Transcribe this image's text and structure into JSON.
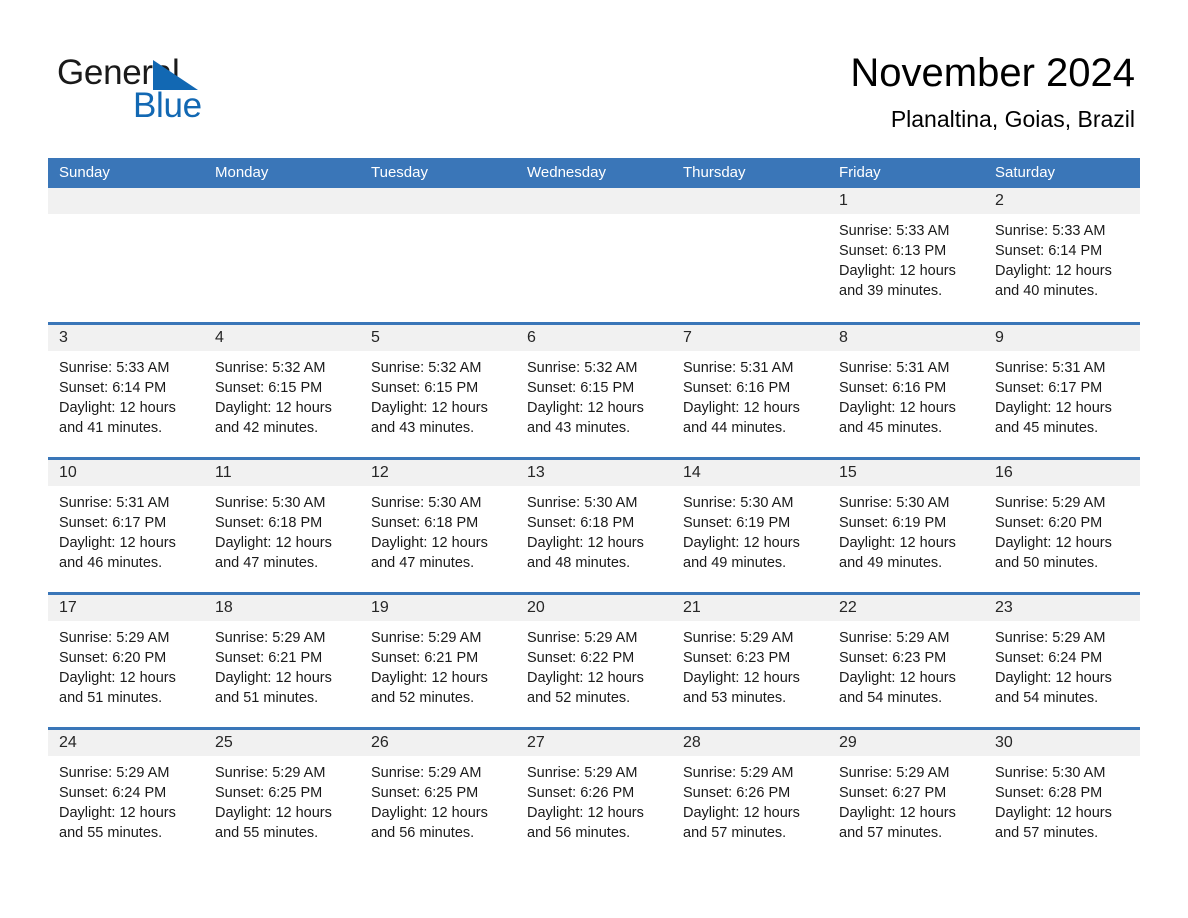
{
  "brand": {
    "name_part1": "General",
    "name_part2": "Blue",
    "triangle_color": "#1268b3",
    "text_color_secondary": "#1268b3"
  },
  "header": {
    "title": "November 2024",
    "location": "Planaltina, Goias, Brazil"
  },
  "theme": {
    "header_row_color": "#3a76b8",
    "day_band_color": "#f1f1f1",
    "row_divider_color": "#3a76b8"
  },
  "calendar": {
    "weekdays": [
      "Sunday",
      "Monday",
      "Tuesday",
      "Wednesday",
      "Thursday",
      "Friday",
      "Saturday"
    ],
    "weeks": [
      [
        {
          "day": "",
          "empty": true
        },
        {
          "day": "",
          "empty": true
        },
        {
          "day": "",
          "empty": true
        },
        {
          "day": "",
          "empty": true
        },
        {
          "day": "",
          "empty": true
        },
        {
          "day": "1",
          "sunrise": "Sunrise: 5:33 AM",
          "sunset": "Sunset: 6:13 PM",
          "daylight": "Daylight: 12 hours and 39 minutes."
        },
        {
          "day": "2",
          "sunrise": "Sunrise: 5:33 AM",
          "sunset": "Sunset: 6:14 PM",
          "daylight": "Daylight: 12 hours and 40 minutes."
        }
      ],
      [
        {
          "day": "3",
          "sunrise": "Sunrise: 5:33 AM",
          "sunset": "Sunset: 6:14 PM",
          "daylight": "Daylight: 12 hours and 41 minutes."
        },
        {
          "day": "4",
          "sunrise": "Sunrise: 5:32 AM",
          "sunset": "Sunset: 6:15 PM",
          "daylight": "Daylight: 12 hours and 42 minutes."
        },
        {
          "day": "5",
          "sunrise": "Sunrise: 5:32 AM",
          "sunset": "Sunset: 6:15 PM",
          "daylight": "Daylight: 12 hours and 43 minutes."
        },
        {
          "day": "6",
          "sunrise": "Sunrise: 5:32 AM",
          "sunset": "Sunset: 6:15 PM",
          "daylight": "Daylight: 12 hours and 43 minutes."
        },
        {
          "day": "7",
          "sunrise": "Sunrise: 5:31 AM",
          "sunset": "Sunset: 6:16 PM",
          "daylight": "Daylight: 12 hours and 44 minutes."
        },
        {
          "day": "8",
          "sunrise": "Sunrise: 5:31 AM",
          "sunset": "Sunset: 6:16 PM",
          "daylight": "Daylight: 12 hours and 45 minutes."
        },
        {
          "day": "9",
          "sunrise": "Sunrise: 5:31 AM",
          "sunset": "Sunset: 6:17 PM",
          "daylight": "Daylight: 12 hours and 45 minutes."
        }
      ],
      [
        {
          "day": "10",
          "sunrise": "Sunrise: 5:31 AM",
          "sunset": "Sunset: 6:17 PM",
          "daylight": "Daylight: 12 hours and 46 minutes."
        },
        {
          "day": "11",
          "sunrise": "Sunrise: 5:30 AM",
          "sunset": "Sunset: 6:18 PM",
          "daylight": "Daylight: 12 hours and 47 minutes."
        },
        {
          "day": "12",
          "sunrise": "Sunrise: 5:30 AM",
          "sunset": "Sunset: 6:18 PM",
          "daylight": "Daylight: 12 hours and 47 minutes."
        },
        {
          "day": "13",
          "sunrise": "Sunrise: 5:30 AM",
          "sunset": "Sunset: 6:18 PM",
          "daylight": "Daylight: 12 hours and 48 minutes."
        },
        {
          "day": "14",
          "sunrise": "Sunrise: 5:30 AM",
          "sunset": "Sunset: 6:19 PM",
          "daylight": "Daylight: 12 hours and 49 minutes."
        },
        {
          "day": "15",
          "sunrise": "Sunrise: 5:30 AM",
          "sunset": "Sunset: 6:19 PM",
          "daylight": "Daylight: 12 hours and 49 minutes."
        },
        {
          "day": "16",
          "sunrise": "Sunrise: 5:29 AM",
          "sunset": "Sunset: 6:20 PM",
          "daylight": "Daylight: 12 hours and 50 minutes."
        }
      ],
      [
        {
          "day": "17",
          "sunrise": "Sunrise: 5:29 AM",
          "sunset": "Sunset: 6:20 PM",
          "daylight": "Daylight: 12 hours and 51 minutes."
        },
        {
          "day": "18",
          "sunrise": "Sunrise: 5:29 AM",
          "sunset": "Sunset: 6:21 PM",
          "daylight": "Daylight: 12 hours and 51 minutes."
        },
        {
          "day": "19",
          "sunrise": "Sunrise: 5:29 AM",
          "sunset": "Sunset: 6:21 PM",
          "daylight": "Daylight: 12 hours and 52 minutes."
        },
        {
          "day": "20",
          "sunrise": "Sunrise: 5:29 AM",
          "sunset": "Sunset: 6:22 PM",
          "daylight": "Daylight: 12 hours and 52 minutes."
        },
        {
          "day": "21",
          "sunrise": "Sunrise: 5:29 AM",
          "sunset": "Sunset: 6:23 PM",
          "daylight": "Daylight: 12 hours and 53 minutes."
        },
        {
          "day": "22",
          "sunrise": "Sunrise: 5:29 AM",
          "sunset": "Sunset: 6:23 PM",
          "daylight": "Daylight: 12 hours and 54 minutes."
        },
        {
          "day": "23",
          "sunrise": "Sunrise: 5:29 AM",
          "sunset": "Sunset: 6:24 PM",
          "daylight": "Daylight: 12 hours and 54 minutes."
        }
      ],
      [
        {
          "day": "24",
          "sunrise": "Sunrise: 5:29 AM",
          "sunset": "Sunset: 6:24 PM",
          "daylight": "Daylight: 12 hours and 55 minutes."
        },
        {
          "day": "25",
          "sunrise": "Sunrise: 5:29 AM",
          "sunset": "Sunset: 6:25 PM",
          "daylight": "Daylight: 12 hours and 55 minutes."
        },
        {
          "day": "26",
          "sunrise": "Sunrise: 5:29 AM",
          "sunset": "Sunset: 6:25 PM",
          "daylight": "Daylight: 12 hours and 56 minutes."
        },
        {
          "day": "27",
          "sunrise": "Sunrise: 5:29 AM",
          "sunset": "Sunset: 6:26 PM",
          "daylight": "Daylight: 12 hours and 56 minutes."
        },
        {
          "day": "28",
          "sunrise": "Sunrise: 5:29 AM",
          "sunset": "Sunset: 6:26 PM",
          "daylight": "Daylight: 12 hours and 57 minutes."
        },
        {
          "day": "29",
          "sunrise": "Sunrise: 5:29 AM",
          "sunset": "Sunset: 6:27 PM",
          "daylight": "Daylight: 12 hours and 57 minutes."
        },
        {
          "day": "30",
          "sunrise": "Sunrise: 5:30 AM",
          "sunset": "Sunset: 6:28 PM",
          "daylight": "Daylight: 12 hours and 57 minutes."
        }
      ]
    ]
  }
}
